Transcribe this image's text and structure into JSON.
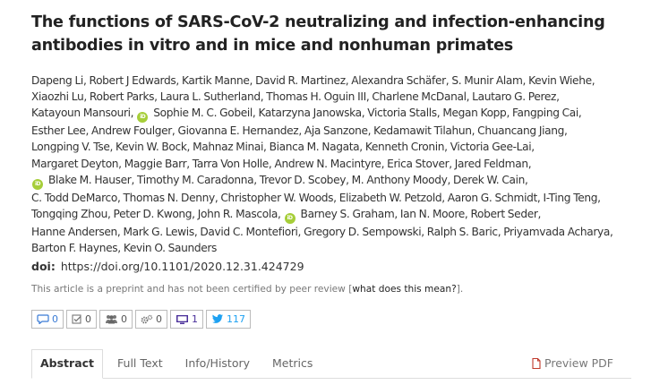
{
  "article": {
    "title_line1": "The functions of SARS-CoV-2 neutralizing and infection-enhancing",
    "title_line2": "antibodies in vitro and in mice and nonhuman primates",
    "author_lines": [
      [
        "Dapeng Li, Robert J Edwards, Kartik Manne, David R. Martinez, Alexandra Schäfer, S. Munir Alam, Kevin Wiehe,"
      ],
      [
        "Xiaozhi Lu, Robert Parks, Laura L. Sutherland, Thomas H. Oguin III, Charlene McDanal, Lautaro G. Perez,"
      ],
      [
        "Katayoun Mansouri, ",
        "ORCID",
        " Sophie M. C. Gobeil, Katarzyna Janowska, Victoria Stalls, Megan Kopp, Fangping Cai,"
      ],
      [
        "Esther Lee, Andrew Foulger, Giovanna E. Hernandez, Aja Sanzone, Kedamawit Tilahun, Chuancang Jiang,"
      ],
      [
        "Longping V. Tse, Kevin W. Bock, Mahnaz Minai, Bianca M. Nagata, Kenneth Cronin, Victoria Gee-Lai,"
      ],
      [
        "Margaret Deyton, Maggie Barr, Tarra Von Holle, Andrew N. Macintyre, Erica Stover, Jared Feldman,"
      ],
      [
        "ORCID",
        " Blake M. Hauser, Timothy M. Caradonna, Trevor D. Scobey, M. Anthony Moody, Derek W. Cain,"
      ],
      [
        "C. Todd DeMarco, Thomas N. Denny, Christopher W. Woods, Elizabeth W. Petzold, Aaron G. Schmidt, I-Ting Teng,"
      ],
      [
        "Tongqing Zhou, Peter D. Kwong, John R. Mascola, ",
        "ORCID",
        " Barney S. Graham, Ian N. Moore, Robert Seder,"
      ],
      [
        "Hanne Andersen, Mark G. Lewis, David C. Montefiori, Gregory D. Sempowski, Ralph S. Baric, Priyamvada Acharya,"
      ],
      [
        "Barton F. Haynes, Kevin O. Saunders"
      ]
    ],
    "orcid_label": "iD",
    "doi_label": "doi:",
    "doi_url": "https://doi.org/10.1101/2020.12.31.424729",
    "preprint_note": "This article is a preprint and has not been certified by peer review [",
    "preprint_link": "what does this mean?",
    "preprint_note_end": "]."
  },
  "badges": {
    "comments": "0",
    "checks": "0",
    "users": "0",
    "gears": "0",
    "display": "1",
    "twitter": "117"
  },
  "tabs": {
    "abstract": "Abstract",
    "full_text": "Full Text",
    "info_history": "Info/History",
    "metrics": "Metrics",
    "preview_pdf": "Preview PDF"
  },
  "colors": {
    "orcid": "#a6ce39",
    "twitter": "#1da1f2",
    "comment_blue": "#3a7bd5",
    "display_purple": "#4a2f9a",
    "pdf_red": "#c0392b"
  }
}
